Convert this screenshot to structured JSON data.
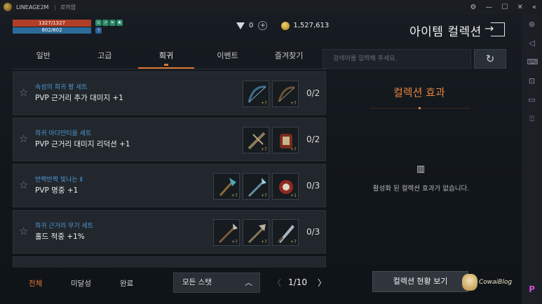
{
  "window": {
    "app_name": "LINEAGE2M",
    "separator": "|",
    "subtitle": "로하암",
    "controls": [
      "⚙",
      "—",
      "☐",
      "✕",
      "«"
    ]
  },
  "sidebar_icons": [
    "antenna-icon",
    "volume-icon",
    "keyboard-icon",
    "crop-icon",
    "folder-icon",
    "apk-icon"
  ],
  "sidebar_glyphs": [
    "⊛",
    "◁",
    "⌨",
    "⊡",
    "▭",
    "⍐"
  ],
  "hud": {
    "hp": "1327/1327",
    "mp": "802/802",
    "hp_fraction": 1.0,
    "mp_fraction": 1.0,
    "buff_glyphs": [
      "⚔",
      "↗",
      "✒",
      "♣"
    ],
    "buff2_glyph": "⇑",
    "diamonds": "0",
    "plus": "+",
    "adena": "1,527,613"
  },
  "header": {
    "title": "아이템 컬렉션"
  },
  "tabs": [
    {
      "label": "일반",
      "active": false
    },
    {
      "label": "고급",
      "active": false
    },
    {
      "label": "희귀",
      "active": true
    },
    {
      "label": "이벤트",
      "active": false
    },
    {
      "label": "즐겨찾기",
      "active": false
    }
  ],
  "search": {
    "placeholder": "검색어를 입력해 주세요."
  },
  "collections": [
    {
      "set_name": "속성의 희귀 활 세트",
      "effect": "PVP 근거리 추가 대미지 +1",
      "progress": "0/2",
      "favorite": false,
      "items": [
        {
          "icon": "bow-icon",
          "level": "+7"
        },
        {
          "icon": "bow-icon",
          "level": "+7"
        }
      ]
    },
    {
      "set_name": "희귀 아다만티움 세트",
      "effect": "PVP 근거리 대미지 리덕션 +1",
      "progress": "0/2",
      "favorite": false,
      "items": [
        {
          "icon": "crossbow-icon",
          "level": "+7"
        },
        {
          "icon": "armor-icon",
          "level": "+7"
        }
      ]
    },
    {
      "set_name": "반짝반짝 빛나는 Ⅱ",
      "effect": "PVP 명중 +1",
      "progress": "0/3",
      "favorite": false,
      "items": [
        {
          "icon": "axe-icon",
          "level": "+7"
        },
        {
          "icon": "spear-icon",
          "level": "+7"
        },
        {
          "icon": "bracer-icon",
          "level": "+1"
        }
      ]
    },
    {
      "set_name": "희귀 근거리 무기 세트",
      "effect": "홀드 적중 +1%",
      "progress": "0/3",
      "favorite": false,
      "items": [
        {
          "icon": "spear-icon",
          "level": "+7"
        },
        {
          "icon": "polearm-icon",
          "level": "+7"
        },
        {
          "icon": "blade-icon",
          "level": "+7"
        }
      ]
    }
  ],
  "collection_effect": {
    "title": "컬렉션 효과",
    "empty_message": "활성화 된 컬렉션 효과가 없습니다."
  },
  "filters": [
    {
      "label": "전체",
      "active": true
    },
    {
      "label": "미달성",
      "active": false
    },
    {
      "label": "완료",
      "active": false
    }
  ],
  "stat_select": {
    "label": "모든 스탯"
  },
  "pagination": {
    "current": 1,
    "total": 10,
    "text": "1/10"
  },
  "status_button": {
    "label": "컬렉션 현황 보기"
  },
  "watermark": {
    "text": "CowaiBlog"
  },
  "colors": {
    "accent": "#e7833d",
    "set_name": "#4d96d4",
    "hp": "#b13f27",
    "mp": "#2b6b9a"
  }
}
